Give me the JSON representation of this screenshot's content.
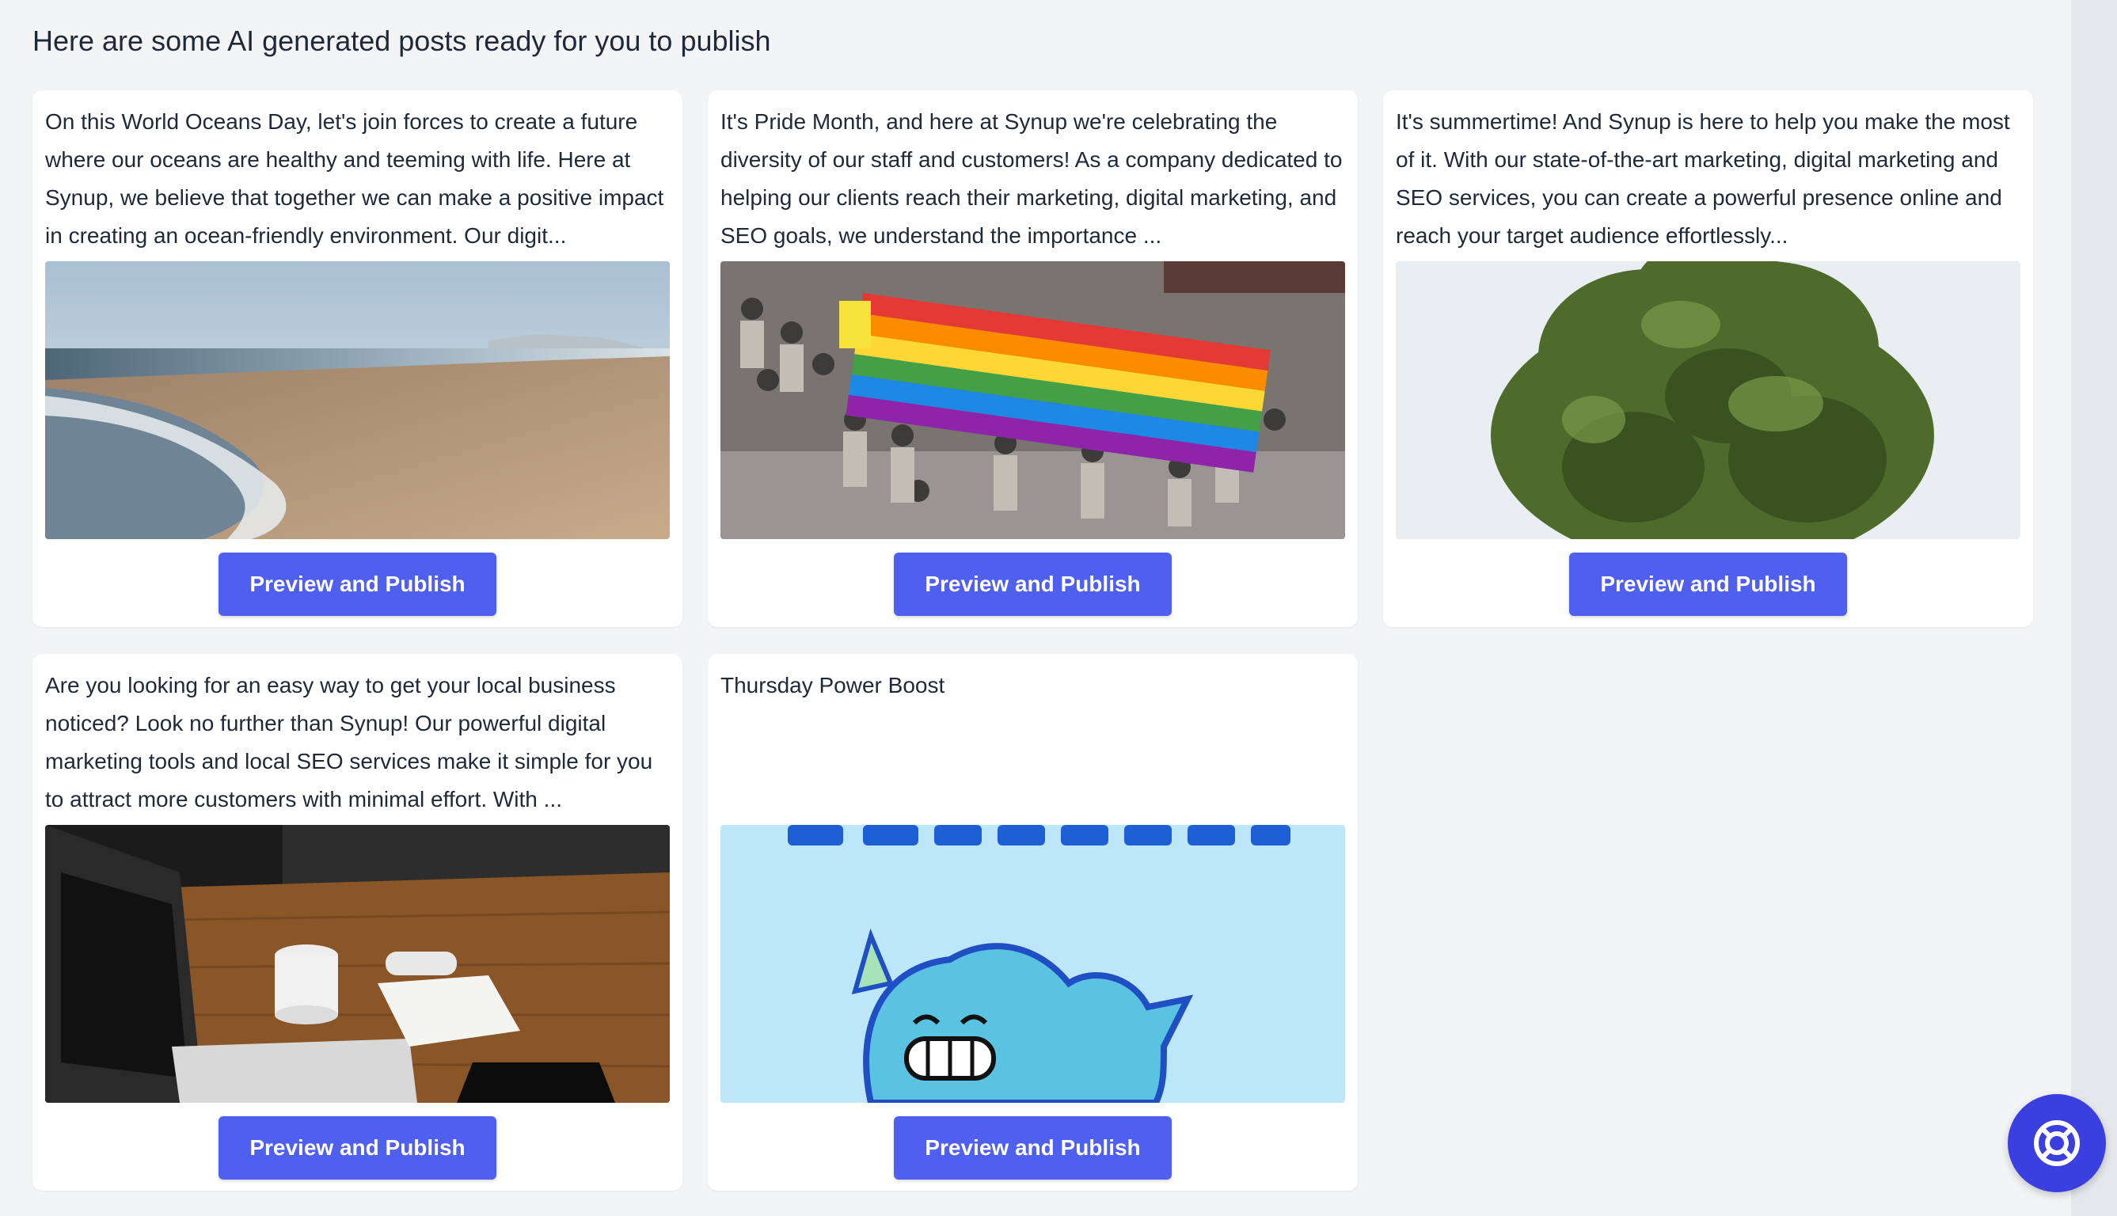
{
  "page": {
    "heading": "Here are some AI generated posts ready for you to publish"
  },
  "posts": [
    {
      "text": "On this World Oceans Day, let's join forces to create a future where our oceans are healthy and teeming with life. Here at Synup, we believe that together we can make a positive impact in creating an ocean-friendly environment. Our digit...",
      "image": "beach-photo",
      "button_label": "Preview and Publish"
    },
    {
      "text": "It's Pride Month, and here at Synup we're celebrating the diversity of our staff and customers! As a company dedicated to helping our clients reach their marketing, digital marketing, and SEO goals, we understand the importance ...",
      "image": "pride-parade-photo",
      "button_label": "Preview and Publish"
    },
    {
      "text": "It's summertime! And Synup is here to help you make the most of it. With our state-of-the-art marketing, digital marketing and SEO services, you can create a powerful presence online and reach your target audience effortlessly...",
      "image": "tree-photo",
      "button_label": "Preview and Publish"
    },
    {
      "text": "Are you looking for an easy way to get your local business noticed? Look no further than Synup! Our powerful digital marketing tools and local SEO services make it simple for you to attract more customers with minimal effort. With ...",
      "image": "desk-laptop-coffee-photo",
      "button_label": "Preview and Publish"
    },
    {
      "text": "Thursday Power Boost",
      "image": "thursday-cartoon-illustration",
      "button_label": "Preview and Publish"
    }
  ],
  "help_button": {
    "icon": "lifebuoy-icon"
  },
  "colors": {
    "accent": "#4f5ff0",
    "help_fab": "#3b3fe0",
    "page_bg": "#f3f4f6",
    "card_bg": "#ffffff"
  }
}
